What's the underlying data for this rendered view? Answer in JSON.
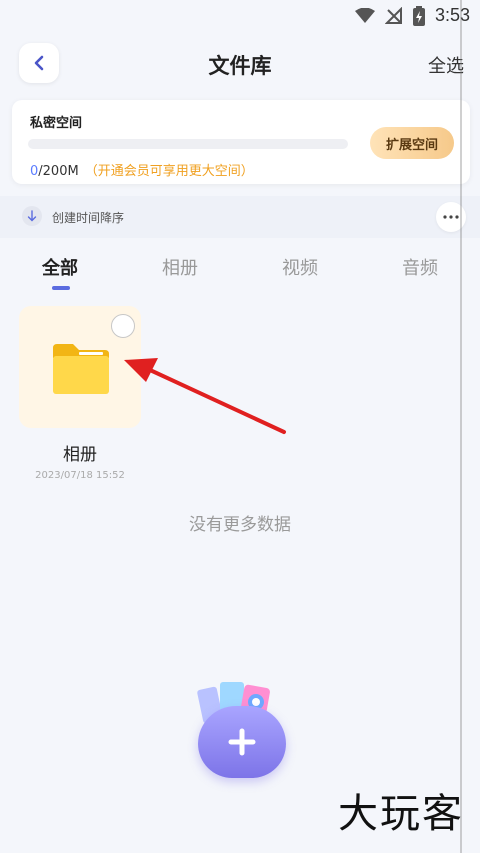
{
  "status_bar": {
    "time": "3:53"
  },
  "header": {
    "title": "文件库",
    "select_all": "全选"
  },
  "storage": {
    "title": "私密空间",
    "used": "0",
    "total": "/200M",
    "tip": "（开通会员可享用更大空间）",
    "expand_label": "扩展空间",
    "used_fraction": 0
  },
  "sort": {
    "label": "创建时间降序"
  },
  "tabs": [
    {
      "label": "全部",
      "active": true
    },
    {
      "label": "相册",
      "active": false
    },
    {
      "label": "视频",
      "active": false
    },
    {
      "label": "音频",
      "active": false
    }
  ],
  "folders": [
    {
      "name": "相册",
      "date": "2023/07/18 15:52"
    }
  ],
  "empty_text": "没有更多数据",
  "watermark": "大玩客",
  "colors": {
    "accent": "#5b6ce0",
    "folder": "#ffd84a",
    "arrow": "#e02020"
  }
}
